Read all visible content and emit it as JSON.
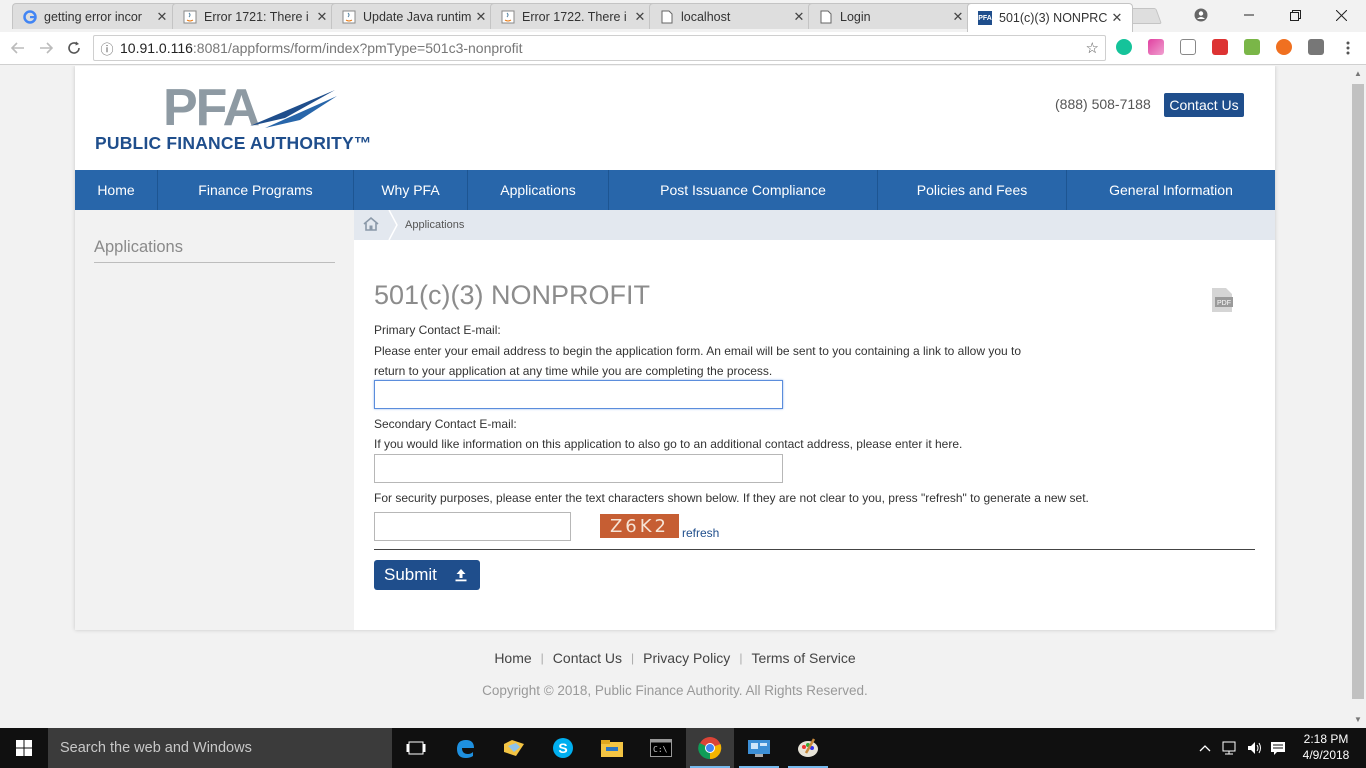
{
  "browser": {
    "tabs": [
      {
        "title": "getting error incor",
        "icon": "google-icon"
      },
      {
        "title": "Error 1721: There i",
        "icon": "java-icon"
      },
      {
        "title": "Update Java runtim",
        "icon": "java-icon"
      },
      {
        "title": "Error 1722. There i",
        "icon": "java-icon"
      },
      {
        "title": "localhost",
        "icon": "page-icon"
      },
      {
        "title": "Login",
        "icon": "page-icon"
      },
      {
        "title": "501(c)(3) NONPRC",
        "icon": "pfa-icon"
      }
    ],
    "active_tab_index": 6,
    "favicon_pfa": "PFA",
    "url_host": "10.91.0.116",
    "url_rest": ":8081/appforms/form/index?pmType=501c3-nonprofit"
  },
  "site": {
    "logo_mark": "PFA",
    "logo_name": "PUBLIC FINANCE AUTHORITY™",
    "phone": "(888) 508-7188",
    "contact_button": "Contact Us",
    "nav": [
      "Home",
      "Finance Programs",
      "Why PFA",
      "Applications",
      "Post Issuance Compliance",
      "Policies and Fees",
      "General Information"
    ],
    "sidebar_heading": "Applications",
    "breadcrumb": "Applications"
  },
  "form": {
    "title": "501(c)(3) NONPROFIT",
    "pdf_label": "PDF",
    "primary_label": "Primary Contact E-mail:",
    "primary_help_1": "Please enter your email address to begin the application form. An email will be sent to you containing a link to allow you to",
    "primary_help_2": "return to your application at any time while you are completing the process.",
    "primary_value": "",
    "secondary_label": "Secondary Contact E-mail:",
    "secondary_help": "If you would like information on this application to also go to an additional contact address, please enter it here.",
    "secondary_value": "",
    "security_help": "For security purposes, please enter the text characters shown below. If they are not clear to you, press \"refresh\" to generate a new set.",
    "captcha_text": "Z6K2",
    "captcha_value": "",
    "refresh_label": "refresh",
    "submit_label": "Submit"
  },
  "footer": {
    "links": [
      "Home",
      "Contact Us",
      "Privacy Policy",
      "Terms of Service"
    ],
    "copyright": "Copyright © 2018, Public Finance Authority. All Rights Reserved."
  },
  "taskbar": {
    "search_placeholder": "Search the web and Windows",
    "time": "2:18 PM",
    "date": "4/9/2018"
  },
  "colors": {
    "brand_blue": "#1f4e8c",
    "nav_blue": "#2866aa",
    "captcha_bg": "#c65e33"
  }
}
